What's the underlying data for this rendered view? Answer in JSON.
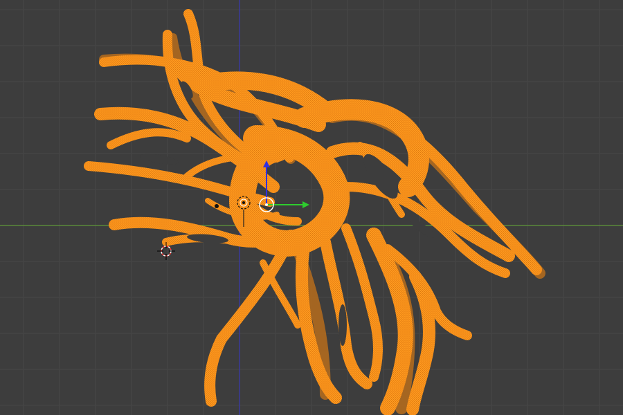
{
  "app": {
    "view": "3d-viewport",
    "mode": "edit-mesh",
    "selection_state": "all-selected"
  },
  "colors": {
    "background": "#3d3d3d",
    "grid_line": "#474747",
    "x_axis": "#5a8a3a",
    "y_axis": "#3a3a9a",
    "mesh_fill": "#ff9a1f",
    "mesh_wire": "#e07a10",
    "mesh_shadow": "#b05a10",
    "gizmo_x": "#2ecc2e",
    "gizmo_z": "#3030e0",
    "gizmo_center": "#ffffff",
    "cursor_ring": "#ff3030"
  },
  "icons": {
    "cursor": "3d-cursor-icon",
    "pivot": "pivot-point-icon",
    "transform": "transform-gizmo-icon"
  },
  "object": {
    "type": "mesh",
    "shape": "hair-strands",
    "strand_count": 13
  }
}
